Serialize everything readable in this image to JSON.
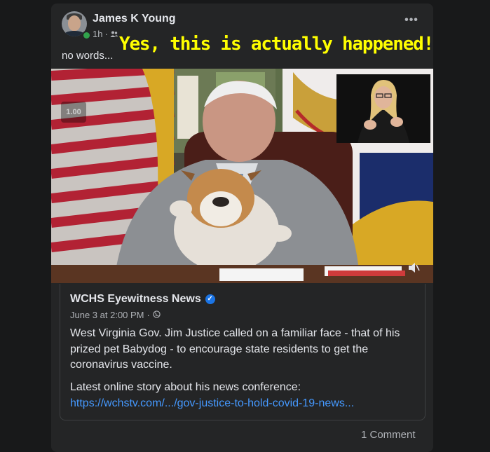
{
  "post": {
    "author": "James K Young",
    "time": "1h",
    "separator": "·",
    "text": "no words...",
    "more_label": "•••",
    "overlay_caption": "Yes, this is actually happened!"
  },
  "video": {
    "speed_label": "1.00",
    "description": "video frame: man at desk holding a bulldog with a sign-language interpreter inset"
  },
  "link_card": {
    "page_name": "WCHS Eyewitness News",
    "verified": "✓",
    "date": "June 3 at 2:00 PM",
    "separator": "·",
    "body": "West Virginia Gov. Jim Justice called on a familiar face - that of his prized pet Babydog - to encourage state residents to get the coronavirus vaccine.",
    "link_label": "Latest online story about his news conference:",
    "link": "https://wchstv.com/.../gov-justice-to-hold-covid-19-news..."
  },
  "footer": {
    "comments": "1 Comment"
  },
  "colors": {
    "background": "#18191a",
    "card": "#242526",
    "link": "#4599ff",
    "caption": "#ffff00",
    "online": "#31a24c"
  },
  "icons": [
    "avatar",
    "friends-icon",
    "more-icon",
    "volume-icon",
    "globe-icon",
    "verified-icon"
  ]
}
